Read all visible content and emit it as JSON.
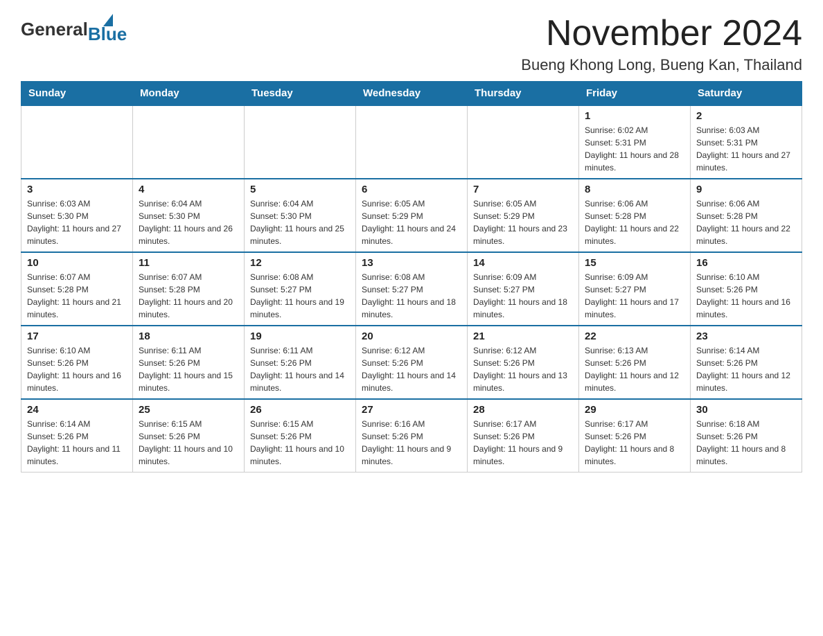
{
  "logo": {
    "general": "General",
    "blue": "Blue"
  },
  "title": {
    "month": "November 2024",
    "location": "Bueng Khong Long, Bueng Kan, Thailand"
  },
  "weekdays": [
    "Sunday",
    "Monday",
    "Tuesday",
    "Wednesday",
    "Thursday",
    "Friday",
    "Saturday"
  ],
  "weeks": [
    [
      {
        "day": "",
        "info": ""
      },
      {
        "day": "",
        "info": ""
      },
      {
        "day": "",
        "info": ""
      },
      {
        "day": "",
        "info": ""
      },
      {
        "day": "",
        "info": ""
      },
      {
        "day": "1",
        "info": "Sunrise: 6:02 AM\nSunset: 5:31 PM\nDaylight: 11 hours and 28 minutes."
      },
      {
        "day": "2",
        "info": "Sunrise: 6:03 AM\nSunset: 5:31 PM\nDaylight: 11 hours and 27 minutes."
      }
    ],
    [
      {
        "day": "3",
        "info": "Sunrise: 6:03 AM\nSunset: 5:30 PM\nDaylight: 11 hours and 27 minutes."
      },
      {
        "day": "4",
        "info": "Sunrise: 6:04 AM\nSunset: 5:30 PM\nDaylight: 11 hours and 26 minutes."
      },
      {
        "day": "5",
        "info": "Sunrise: 6:04 AM\nSunset: 5:30 PM\nDaylight: 11 hours and 25 minutes."
      },
      {
        "day": "6",
        "info": "Sunrise: 6:05 AM\nSunset: 5:29 PM\nDaylight: 11 hours and 24 minutes."
      },
      {
        "day": "7",
        "info": "Sunrise: 6:05 AM\nSunset: 5:29 PM\nDaylight: 11 hours and 23 minutes."
      },
      {
        "day": "8",
        "info": "Sunrise: 6:06 AM\nSunset: 5:28 PM\nDaylight: 11 hours and 22 minutes."
      },
      {
        "day": "9",
        "info": "Sunrise: 6:06 AM\nSunset: 5:28 PM\nDaylight: 11 hours and 22 minutes."
      }
    ],
    [
      {
        "day": "10",
        "info": "Sunrise: 6:07 AM\nSunset: 5:28 PM\nDaylight: 11 hours and 21 minutes."
      },
      {
        "day": "11",
        "info": "Sunrise: 6:07 AM\nSunset: 5:28 PM\nDaylight: 11 hours and 20 minutes."
      },
      {
        "day": "12",
        "info": "Sunrise: 6:08 AM\nSunset: 5:27 PM\nDaylight: 11 hours and 19 minutes."
      },
      {
        "day": "13",
        "info": "Sunrise: 6:08 AM\nSunset: 5:27 PM\nDaylight: 11 hours and 18 minutes."
      },
      {
        "day": "14",
        "info": "Sunrise: 6:09 AM\nSunset: 5:27 PM\nDaylight: 11 hours and 18 minutes."
      },
      {
        "day": "15",
        "info": "Sunrise: 6:09 AM\nSunset: 5:27 PM\nDaylight: 11 hours and 17 minutes."
      },
      {
        "day": "16",
        "info": "Sunrise: 6:10 AM\nSunset: 5:26 PM\nDaylight: 11 hours and 16 minutes."
      }
    ],
    [
      {
        "day": "17",
        "info": "Sunrise: 6:10 AM\nSunset: 5:26 PM\nDaylight: 11 hours and 16 minutes."
      },
      {
        "day": "18",
        "info": "Sunrise: 6:11 AM\nSunset: 5:26 PM\nDaylight: 11 hours and 15 minutes."
      },
      {
        "day": "19",
        "info": "Sunrise: 6:11 AM\nSunset: 5:26 PM\nDaylight: 11 hours and 14 minutes."
      },
      {
        "day": "20",
        "info": "Sunrise: 6:12 AM\nSunset: 5:26 PM\nDaylight: 11 hours and 14 minutes."
      },
      {
        "day": "21",
        "info": "Sunrise: 6:12 AM\nSunset: 5:26 PM\nDaylight: 11 hours and 13 minutes."
      },
      {
        "day": "22",
        "info": "Sunrise: 6:13 AM\nSunset: 5:26 PM\nDaylight: 11 hours and 12 minutes."
      },
      {
        "day": "23",
        "info": "Sunrise: 6:14 AM\nSunset: 5:26 PM\nDaylight: 11 hours and 12 minutes."
      }
    ],
    [
      {
        "day": "24",
        "info": "Sunrise: 6:14 AM\nSunset: 5:26 PM\nDaylight: 11 hours and 11 minutes."
      },
      {
        "day": "25",
        "info": "Sunrise: 6:15 AM\nSunset: 5:26 PM\nDaylight: 11 hours and 10 minutes."
      },
      {
        "day": "26",
        "info": "Sunrise: 6:15 AM\nSunset: 5:26 PM\nDaylight: 11 hours and 10 minutes."
      },
      {
        "day": "27",
        "info": "Sunrise: 6:16 AM\nSunset: 5:26 PM\nDaylight: 11 hours and 9 minutes."
      },
      {
        "day": "28",
        "info": "Sunrise: 6:17 AM\nSunset: 5:26 PM\nDaylight: 11 hours and 9 minutes."
      },
      {
        "day": "29",
        "info": "Sunrise: 6:17 AM\nSunset: 5:26 PM\nDaylight: 11 hours and 8 minutes."
      },
      {
        "day": "30",
        "info": "Sunrise: 6:18 AM\nSunset: 5:26 PM\nDaylight: 11 hours and 8 minutes."
      }
    ]
  ]
}
